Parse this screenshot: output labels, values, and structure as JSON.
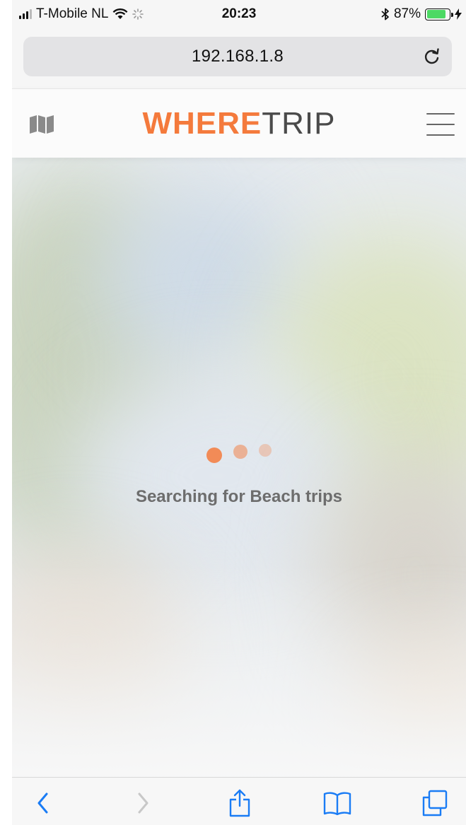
{
  "status_bar": {
    "carrier": "T-Mobile NL",
    "time": "20:23",
    "battery_percent": "87%",
    "battery_level": 0.87
  },
  "browser": {
    "url": "192.168.1.8"
  },
  "header": {
    "logo_primary": "WHERE",
    "logo_secondary": "TRIP"
  },
  "main": {
    "loading_text": "Searching for Beach trips"
  },
  "colors": {
    "accent": "#f47a3c",
    "ios_blue": "#1a7cf5"
  }
}
